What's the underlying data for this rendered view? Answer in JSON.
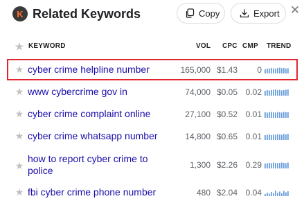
{
  "header": {
    "logo_letter": "K",
    "title": "Related Keywords",
    "copy_label": "Copy",
    "export_label": "Export",
    "close_glyph": "✕"
  },
  "table": {
    "columns": [
      "KEYWORD",
      "VOL",
      "CPC",
      "CMP",
      "TREND"
    ],
    "rows": [
      {
        "keyword": "cyber crime helpline number",
        "vol": "165,000",
        "cpc": "$1.43",
        "cmp": "0",
        "trend": [
          0.6,
          0.7,
          0.7,
          0.8,
          0.75,
          0.7,
          0.8,
          0.85,
          0.75,
          0.8,
          0.7,
          0.75
        ]
      },
      {
        "keyword": "www cybercrime gov in",
        "vol": "74,000",
        "cpc": "$0.05",
        "cmp": "0.02",
        "trend": [
          0.7,
          0.8,
          0.75,
          0.8,
          0.85,
          0.9,
          0.8,
          0.85,
          0.75,
          0.8,
          0.85,
          0.9
        ]
      },
      {
        "keyword": "cyber crime complaint online",
        "vol": "27,100",
        "cpc": "$0.52",
        "cmp": "0.01",
        "trend": [
          0.8,
          0.75,
          0.8,
          0.85,
          0.8,
          0.75,
          0.85,
          0.8,
          0.75,
          0.85,
          0.8,
          0.8
        ]
      },
      {
        "keyword": "cyber crime whatsapp number",
        "vol": "14,800",
        "cpc": "$0.65",
        "cmp": "0.01",
        "trend": [
          0.7,
          0.75,
          0.8,
          0.7,
          0.8,
          0.75,
          0.85,
          0.8,
          0.75,
          0.85,
          0.8,
          0.9
        ]
      },
      {
        "keyword": "how to report cyber crime to police",
        "vol": "1,300",
        "cpc": "$2.26",
        "cmp": "0.29",
        "trend": [
          0.7,
          0.75,
          0.8,
          0.75,
          0.85,
          0.8,
          0.75,
          0.8,
          0.85,
          0.8,
          0.75,
          0.85
        ]
      },
      {
        "keyword": "fbi cyber crime phone number",
        "vol": "480",
        "cpc": "$2.04",
        "cmp": "0.04",
        "trend": [
          0.3,
          0.5,
          0.35,
          0.6,
          0.45,
          0.8,
          0.5,
          0.65,
          0.4,
          0.75,
          0.55,
          0.7
        ]
      }
    ]
  },
  "colors": {
    "keyword_link": "#1a0dab",
    "trend_bar": "#6a9fdc",
    "highlight_border": "#e0262e"
  }
}
